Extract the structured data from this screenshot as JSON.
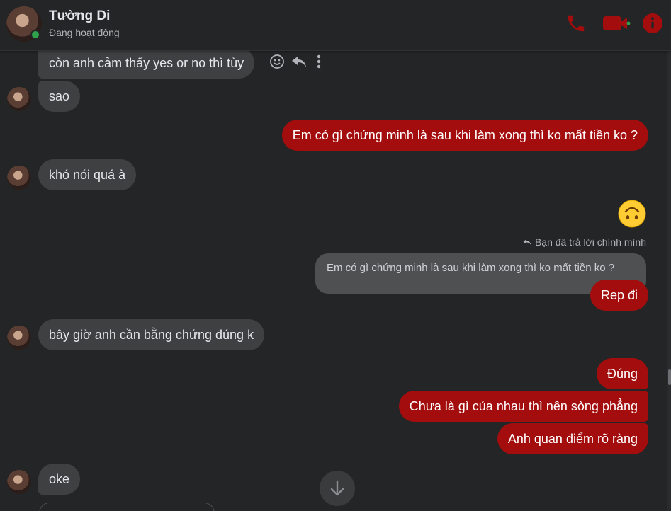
{
  "header": {
    "name": "Tường Di",
    "status": "Đang hoạt động"
  },
  "colors": {
    "accent": "#a30d0d",
    "incoming_bubble": "#3e4042",
    "background": "#242526",
    "online": "#31a24c"
  },
  "icons": [
    "phone-icon",
    "video-call-icon",
    "info-icon",
    "emoji-react-icon",
    "reply-icon",
    "more-options-icon",
    "arrow-down-icon"
  ],
  "messages": {
    "m1": "còn anh cảm thấy yes or no thì tùy",
    "m2": "sao",
    "m3": "Em có gì chứng minh là sau khi làm xong thì ko mất tiền ko ?",
    "m4": "khó nói quá à",
    "m5_emoji": "🙃",
    "reply_meta": "Bạn đã trả lời chính mình",
    "quoted": "Em có gì chứng minh là sau khi làm xong thì ko mất tiền ko ?",
    "m6": "Rep đi",
    "m7": "bây giờ anh cần bằng chứng đúng k",
    "m8": "Đúng",
    "m9": "Chưa là gì của nhau thì nên sòng phẳng",
    "m10": "Anh quan điểm rõ ràng",
    "m11": "oke"
  }
}
